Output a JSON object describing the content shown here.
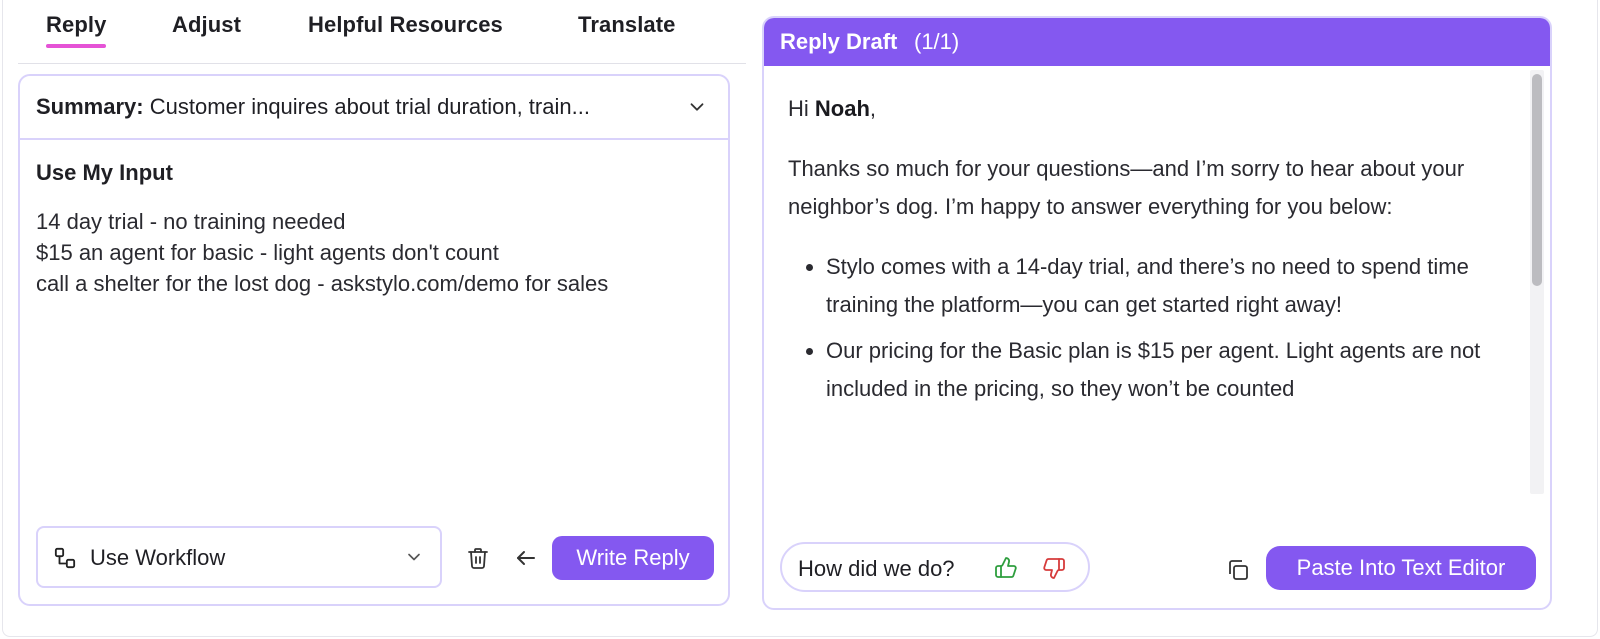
{
  "tabs": {
    "reply": "Reply",
    "adjust": "Adjust",
    "resources": "Helpful Resources",
    "translate": "Translate",
    "active": "Reply"
  },
  "summary": {
    "label": "Summary:",
    "text": "Customer inquires about trial duration, train...",
    "toggle_icon": "chevron-down-icon"
  },
  "input": {
    "title": "Use My Input",
    "lines": "14 day trial - no training needed\n$15 an agent for basic - light agents don't count\ncall a shelter for the lost dog - askstylo.com/demo for sales"
  },
  "workflow": {
    "icon": "workflow-icon",
    "label": "Use Workflow",
    "chevron": "chevron-down-icon"
  },
  "actions": {
    "delete_icon": "trash-icon",
    "back_icon": "arrow-left-icon",
    "write_reply": "Write Reply"
  },
  "draft": {
    "title": "Reply Draft",
    "count": "(1/1)",
    "greeting_prefix": "Hi ",
    "greeting_name": "Noah",
    "greeting_suffix": ",",
    "intro": "Thanks so much for your questions—and I’m sorry to hear about your neighbor’s dog. I’m happy to answer everything for you below:",
    "bullets": [
      "Stylo comes with a 14-day trial, and there’s no need to spend time training the platform—you can get started right away!",
      "Our pricing for the Basic plan is $15 per agent. Light agents are not included in the pricing, so they won’t be counted"
    ]
  },
  "feedback": {
    "label": "How did we do?",
    "up_icon": "thumbs-up-icon",
    "down_icon": "thumbs-down-icon"
  },
  "footer": {
    "copy_icon": "copy-icon",
    "paste": "Paste Into Text Editor"
  },
  "colors": {
    "accent": "#8458f0",
    "tab_underline": "#e553d6",
    "border": "#d9d2fb",
    "thumbs_up": "#2e9e3e",
    "thumbs_down": "#d63b3b"
  }
}
